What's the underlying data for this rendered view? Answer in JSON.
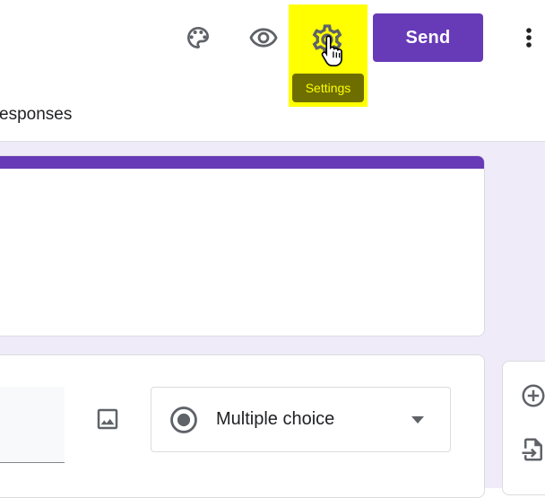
{
  "toolbar": {
    "palette_icon": "palette-icon",
    "preview_icon": "eye-icon",
    "settings_icon": "gear-icon",
    "settings_tooltip": "Settings",
    "send_label": "Send",
    "more_icon": "more-vert-icon"
  },
  "tabs": {
    "responses_label": "esponses"
  },
  "question": {
    "image_icon": "image-icon",
    "type_select": {
      "selected": "Multiple choice",
      "icon": "radio-button-icon"
    }
  },
  "side_toolbar": {
    "items": [
      {
        "icon": "add-circle-icon"
      },
      {
        "icon": "import-icon"
      }
    ]
  },
  "colors": {
    "accent": "#673ab7",
    "canvas_bg": "#f0ebf8",
    "highlight": "#ffff00",
    "tooltip_bg": "#6e6e00"
  }
}
